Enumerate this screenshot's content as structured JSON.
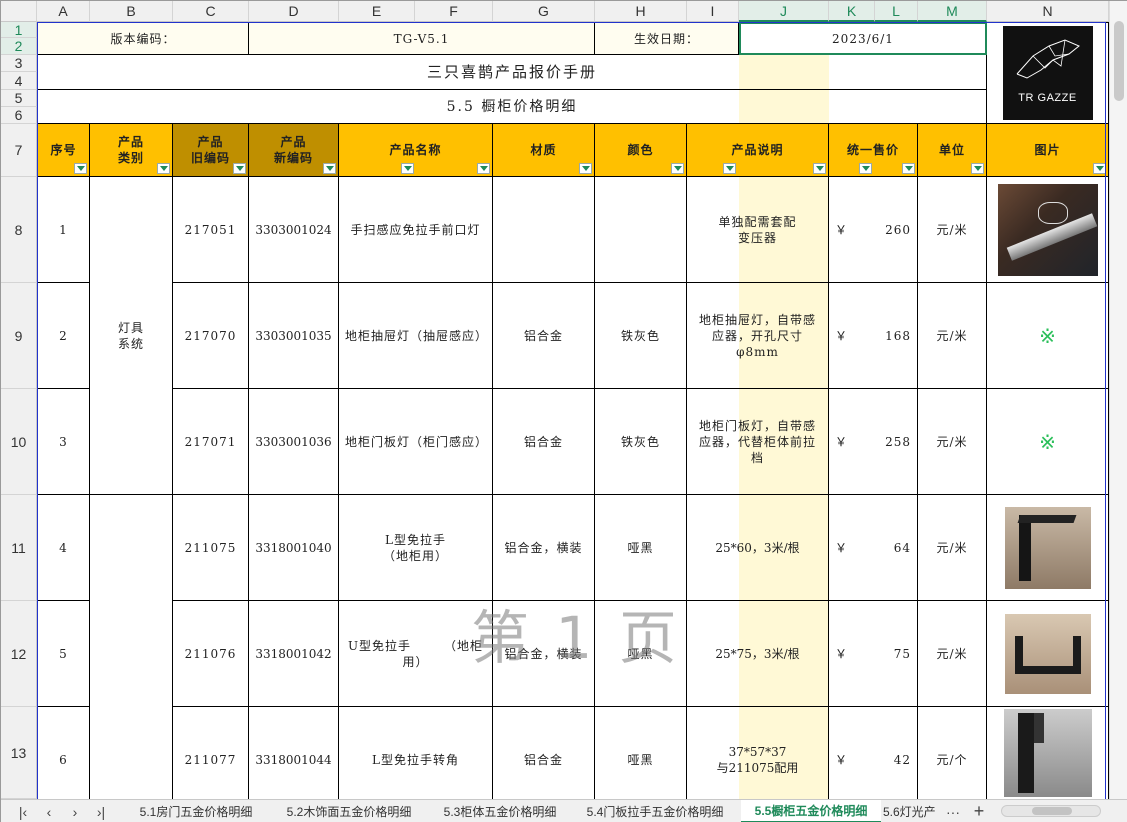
{
  "columns": [
    "A",
    "B",
    "C",
    "D",
    "E",
    "F",
    "G",
    "H",
    "I",
    "J",
    "K",
    "L",
    "M",
    "N"
  ],
  "rows": [
    "1",
    "2",
    "3",
    "4",
    "5",
    "6",
    "7",
    "8",
    "9",
    "10",
    "11",
    "12",
    "13"
  ],
  "info": {
    "version_label": "版本编码：",
    "version_value": "TG-V5.1",
    "date_label": "生效日期：",
    "date_value": "2023/6/1"
  },
  "title": "三只喜鹊产品报价手册",
  "subtitle": "5.5 橱柜价格明细",
  "logo_text": "TR GAZZE",
  "headers": {
    "seq": "序号",
    "category": "产品\n类别",
    "old_code": "产品\n旧编码",
    "new_code": "产品\n新编码",
    "name": "产品名称",
    "material": "材质",
    "color": "颜色",
    "desc": "产品说明",
    "price": "统一售价",
    "unit": "单位",
    "image": "图片"
  },
  "category_lamp": "灯具\n系统",
  "products": [
    {
      "seq": "1",
      "old": "217051",
      "new": "3303001024",
      "name": "手扫感应免拉手前口灯",
      "material": "",
      "color": "",
      "desc": "单独配需套配\n变压器",
      "currency": "￥",
      "price": "260",
      "unit": "元/米"
    },
    {
      "seq": "2",
      "old": "217070",
      "new": "3303001035",
      "name": "地柜抽屉灯（抽屉感应）",
      "material": "铝合金",
      "color": "铁灰色",
      "desc": "地柜抽屉灯，自带感应器，开孔尺寸φ8mm",
      "currency": "￥",
      "price": "168",
      "unit": "元/米",
      "image_mark": "※"
    },
    {
      "seq": "3",
      "old": "217071",
      "new": "3303001036",
      "name": "地柜门板灯（柜门感应）",
      "material": "铝合金",
      "color": "铁灰色",
      "desc": "地柜门板灯，自带感应器，代替柜体前拉档",
      "currency": "￥",
      "price": "258",
      "unit": "元/米",
      "image_mark": "※"
    },
    {
      "seq": "4",
      "old": "211075",
      "new": "3318001040",
      "name": "L型免拉手\n（地柜用）",
      "material": "铝合金，横装",
      "color": "哑黑",
      "desc": "25*60，3米/根",
      "currency": "￥",
      "price": "64",
      "unit": "元/米"
    },
    {
      "seq": "5",
      "old": "211076",
      "new": "3318001042",
      "name": "U型免拉手　　　（地柜用）",
      "material": "铝合金，横装",
      "color": "哑黑",
      "desc": "25*75，3米/根",
      "currency": "￥",
      "price": "75",
      "unit": "元/米"
    },
    {
      "seq": "6",
      "old": "211077",
      "new": "3318001044",
      "name": "L型免拉手转角",
      "material": "铝合金",
      "color": "哑黑",
      "desc": "37*57*37\n与211075配用",
      "currency": "￥",
      "price": "42",
      "unit": "元/个"
    }
  ],
  "watermark": "第 1 页",
  "tabs": [
    "5.1房门五金价格明细",
    "5.2木饰面五金价格明细",
    "5.3柜体五金价格明细",
    "5.4门板拉手五金价格明细",
    "5.5橱柜五金价格明细",
    "5.6灯光产"
  ],
  "active_tab": "5.5橱柜五金价格明细",
  "colors": {
    "header_orange": "#ffc000",
    "header_dark": "#bf8f00",
    "accent_green": "#1f8a5a",
    "highlight_col": "#fff9d6"
  }
}
